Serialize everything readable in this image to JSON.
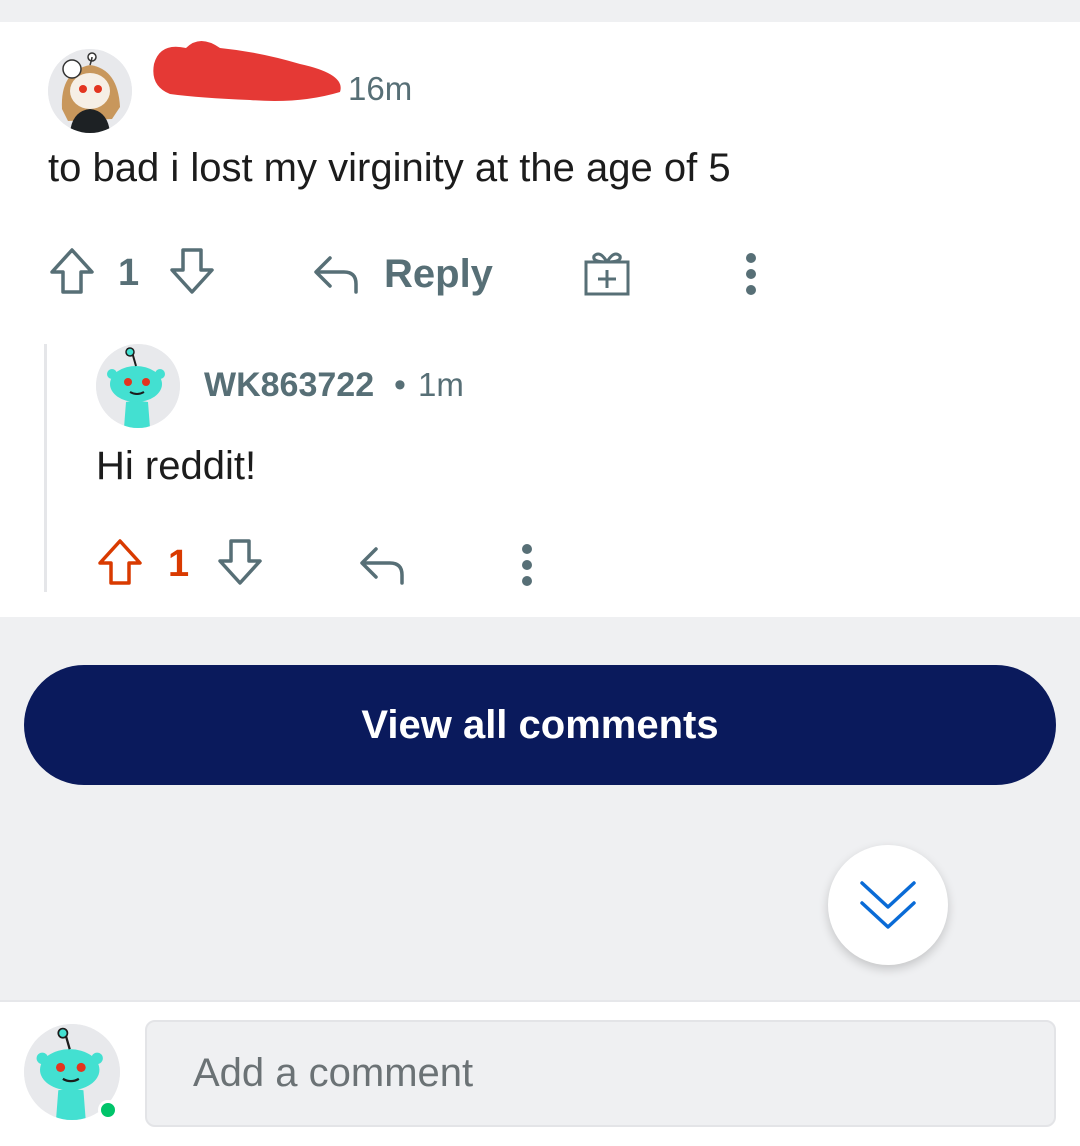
{
  "comment1": {
    "author_redacted": true,
    "time": "16m",
    "body": "to bad i lost my virginity at the age of 5",
    "votes": "1",
    "reply_label": "Reply"
  },
  "comment2": {
    "author": "WK863722",
    "separator": "•",
    "time": "1m",
    "body": "Hi reddit!",
    "votes": "1",
    "upvoted": true
  },
  "view_all_label": "View all comments",
  "composer": {
    "placeholder": "Add a comment",
    "online": true
  },
  "colors": {
    "accent_navy": "#0a1a5c",
    "upvote_orange": "#d93a00",
    "muted": "#576f76",
    "scroll_blue": "#0a6bd6",
    "online_green": "#00c46a",
    "redaction_red": "#e53935"
  },
  "icons": [
    "upvote-icon",
    "downvote-icon",
    "reply-icon",
    "award-icon",
    "more-icon",
    "chevron-double-down-icon",
    "snoo-avatar-icon"
  ]
}
